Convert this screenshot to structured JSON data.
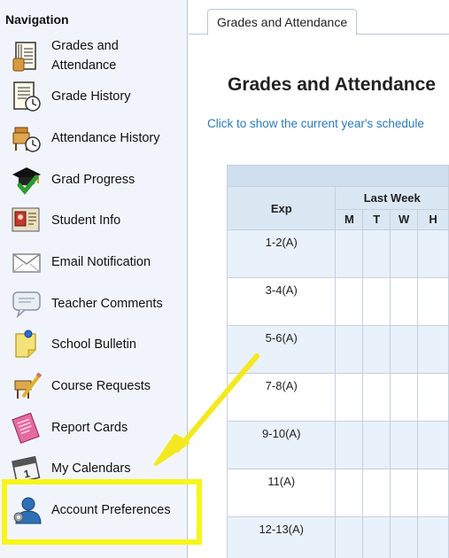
{
  "sidebar": {
    "title": "Navigation",
    "items": [
      {
        "label": "Grades and Attendance",
        "icon": "gradebook-icon"
      },
      {
        "label": "Grade History",
        "icon": "grade-history-icon"
      },
      {
        "label": "Attendance History",
        "icon": "attendance-history-icon"
      },
      {
        "label": "Grad Progress",
        "icon": "graduation-cap-icon"
      },
      {
        "label": "Student Info",
        "icon": "student-id-icon"
      },
      {
        "label": "Email Notification",
        "icon": "envelope-icon"
      },
      {
        "label": "Teacher Comments",
        "icon": "speech-bubble-icon"
      },
      {
        "label": "School Bulletin",
        "icon": "bulletin-note-icon"
      },
      {
        "label": "Course Requests",
        "icon": "course-request-icon"
      },
      {
        "label": "Report Cards",
        "icon": "report-card-icon"
      },
      {
        "label": "My Calendars",
        "icon": "calendar-icon"
      },
      {
        "label": "Account Preferences",
        "icon": "account-user-icon"
      }
    ]
  },
  "main": {
    "tab_label": "Grades and Attendance",
    "page_title": "Grades and Attendance",
    "schedule_link": "Click to show the current year's schedule",
    "table": {
      "exp_header": "Exp",
      "week_header": "Last Week",
      "days": [
        "M",
        "T",
        "W",
        "H"
      ],
      "rows": [
        "1-2(A)",
        "3-4(A)",
        "5-6(A)",
        "7-8(A)",
        "9-10(A)",
        "11(A)",
        "12-13(A)"
      ]
    }
  },
  "colors": {
    "highlight": "#f7f51b",
    "arrow": "#f4e820",
    "link": "#2b79b8",
    "sidebar_bg": "#f1f5fb"
  }
}
